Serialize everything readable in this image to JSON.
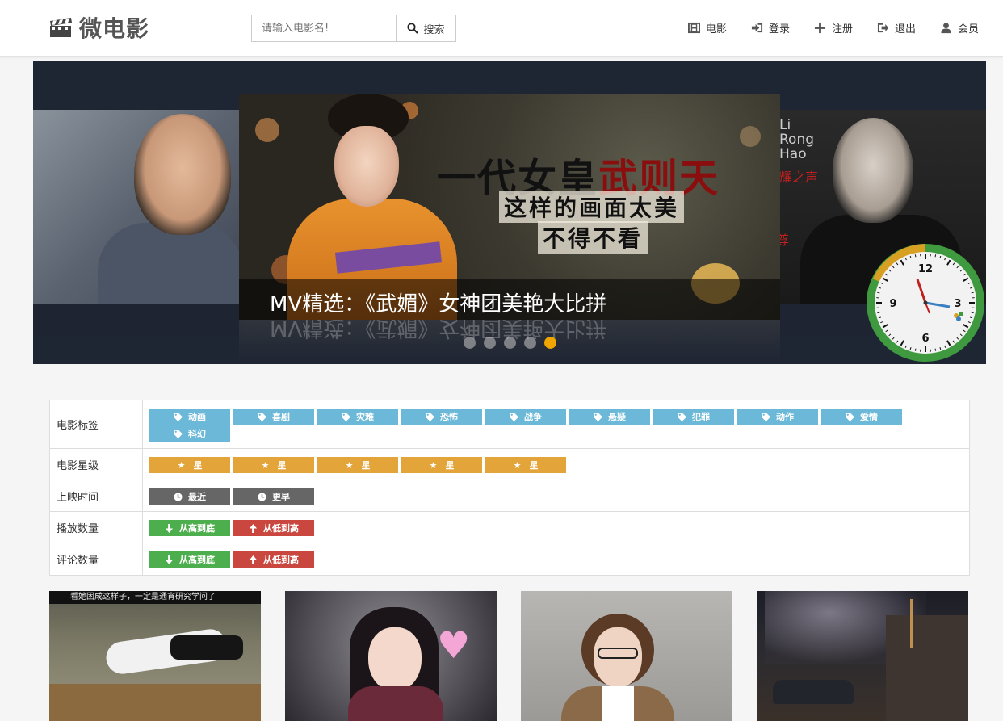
{
  "brand": {
    "name": "微电影"
  },
  "search": {
    "placeholder": "请输入电影名!",
    "button_label": "搜索"
  },
  "nav": [
    {
      "label": "电影",
      "icon": "film-icon"
    },
    {
      "label": "登录",
      "icon": "login-icon"
    },
    {
      "label": "注册",
      "icon": "plus-icon"
    },
    {
      "label": "退出",
      "icon": "logout-icon"
    },
    {
      "label": "会员",
      "icon": "user-icon"
    }
  ],
  "carousel": {
    "caption": "MV精选：《武媚》女神团美艳大比拼",
    "slide_title": "一代女皇武则天",
    "slide_title_red": "武则天",
    "slide_subtitle_1": "这样的画面太美",
    "slide_subtitle_2": "不得不看",
    "right_slide_text": "Li Rong Hao",
    "right_slide_red_text": "耀之声",
    "right_slide_red_text_2": "尊",
    "dot_count": 5,
    "active_dot": 5
  },
  "clock": {
    "hour": 3,
    "minute": 14,
    "numerals": [
      "12",
      "3",
      "6",
      "9"
    ]
  },
  "filters": {
    "tags": {
      "label": "电影标签",
      "items": [
        "动画",
        "喜剧",
        "灾难",
        "恐怖",
        "战争",
        "悬疑",
        "犯罪",
        "动作",
        "爱情",
        "科幻"
      ]
    },
    "stars": {
      "label": "电影星级",
      "items": [
        "星",
        "星",
        "星",
        "星",
        "星"
      ]
    },
    "time": {
      "label": "上映时间",
      "items": [
        "最近",
        "更早"
      ]
    },
    "plays": {
      "label": "播放数量",
      "items": [
        "从高到底",
        "从低到高"
      ]
    },
    "comments": {
      "label": "评论数量",
      "items": [
        "从高到底",
        "从低到高"
      ]
    }
  },
  "thumbnails": [
    {
      "caption": "看她困成这样子，一定是通宵研究学问了"
    },
    {
      "caption": ""
    },
    {
      "caption": ""
    },
    {
      "caption": ""
    }
  ],
  "colors": {
    "tag_blue": "#6bb8d8",
    "star_orange": "#e3a43a",
    "time_gray": "#666666",
    "sort_green": "#4cae4c",
    "sort_red": "#c9473f",
    "active_dot": "#f0a500"
  }
}
